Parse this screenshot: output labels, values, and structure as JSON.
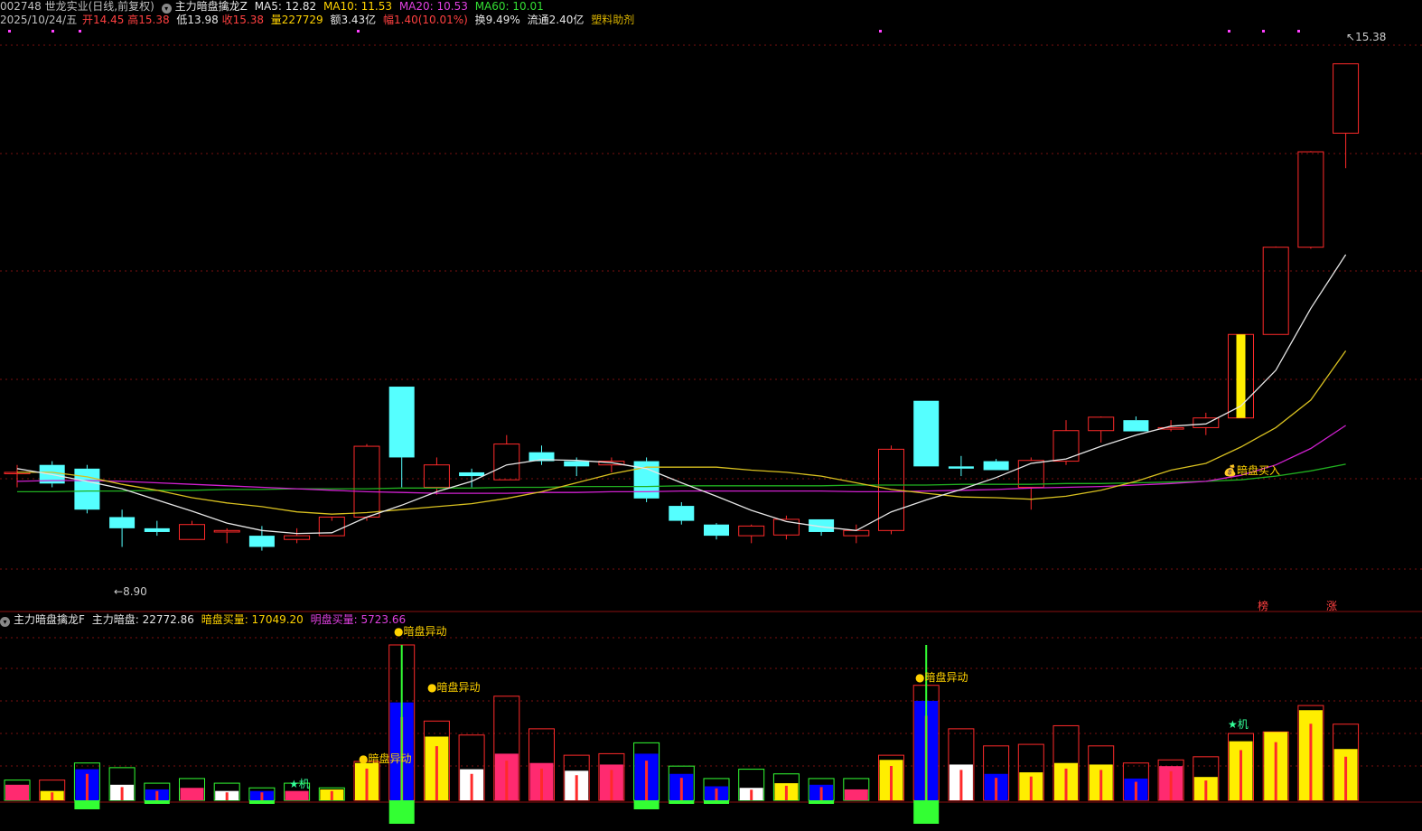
{
  "header": {
    "code_name": "002748 世龙实业(日线,前复权)",
    "indicator_main": "主力暗盘擒龙Z",
    "ma5": "MA5: 12.82",
    "ma10": "MA10: 11.53",
    "ma20": "MA20: 10.53",
    "ma60": "MA60: 10.01",
    "date": "2025/10/24/五",
    "open": "开14.45",
    "high": "高15.38",
    "low": "低13.98",
    "close": "收15.38",
    "volume": "量227729",
    "amount": "额3.43亿",
    "change": "幅1.40(10.01%)",
    "turnover": "换9.49%",
    "float_cap": "流通2.40亿",
    "concept": "塑料助剂"
  },
  "sub_header": {
    "indicator_name": "主力暗盘擒龙F",
    "main_label": "主力暗盘: 22772.86",
    "dark_label": "暗盘买量: 17049.20",
    "light_label": "明盘买量: 5723.66"
  },
  "annotations": {
    "high_price": "15.38",
    "low_price": "8.90",
    "buy_signal": "暗盘买入",
    "bang": "榜",
    "zhang": "涨",
    "anomaly": "●暗盘异动",
    "ji": "★机"
  },
  "colors": {
    "up": "#ff2a2a",
    "down": "#55ffff",
    "ma5": "#e6e6e6",
    "ma10": "#d8c020",
    "ma20": "#d020d0",
    "ma60": "#20b020",
    "grid": "#7a1010",
    "yellow": "#ffee00",
    "magenta": "#ff2a70",
    "blue": "#0000ff",
    "green": "#33ff33"
  },
  "price_chart": {
    "ymin": 8.3,
    "ymax": 15.8,
    "candles": [
      [
        9.9,
        10.0,
        9.7,
        9.9
      ],
      [
        10.0,
        10.05,
        9.7,
        9.75
      ],
      [
        9.95,
        10.0,
        9.35,
        9.4
      ],
      [
        9.3,
        9.4,
        8.9,
        9.15
      ],
      [
        9.15,
        9.25,
        9.05,
        9.1
      ],
      [
        9.0,
        9.25,
        9.0,
        9.2
      ],
      [
        9.1,
        9.15,
        8.95,
        9.12
      ],
      [
        9.05,
        9.18,
        8.85,
        8.9
      ],
      [
        9.0,
        9.15,
        8.95,
        9.05
      ],
      [
        9.05,
        9.25,
        9.05,
        9.3
      ],
      [
        9.3,
        10.28,
        9.25,
        10.25
      ],
      [
        11.05,
        11.05,
        9.7,
        10.1
      ],
      [
        9.7,
        10.1,
        9.6,
        10.0
      ],
      [
        9.9,
        9.95,
        9.7,
        9.85
      ],
      [
        9.8,
        10.4,
        9.8,
        10.28
      ],
      [
        10.17,
        10.26,
        10.0,
        10.05
      ],
      [
        10.05,
        10.1,
        9.85,
        9.98
      ],
      [
        10.0,
        10.1,
        9.9,
        10.05
      ],
      [
        10.05,
        10.1,
        9.5,
        9.55
      ],
      [
        9.45,
        9.5,
        9.2,
        9.25
      ],
      [
        9.2,
        9.22,
        9.0,
        9.05
      ],
      [
        9.05,
        9.2,
        8.95,
        9.18
      ],
      [
        9.06,
        9.32,
        9.0,
        9.27
      ],
      [
        9.27,
        9.27,
        9.05,
        9.1
      ],
      [
        9.05,
        9.2,
        8.95,
        9.12
      ],
      [
        9.12,
        10.26,
        9.07,
        10.21
      ],
      [
        10.86,
        10.86,
        9.98,
        9.98
      ],
      [
        9.98,
        10.12,
        9.85,
        9.95
      ],
      [
        10.05,
        10.08,
        9.95,
        9.93
      ],
      [
        9.7,
        10.1,
        9.4,
        10.06
      ],
      [
        10.05,
        10.6,
        10.0,
        10.46
      ],
      [
        10.46,
        10.65,
        10.3,
        10.64
      ],
      [
        10.6,
        10.65,
        10.45,
        10.45
      ],
      [
        10.48,
        10.6,
        10.45,
        10.5
      ],
      [
        10.5,
        10.7,
        10.4,
        10.63
      ],
      [
        10.63,
        11.75,
        10.63,
        11.75
      ],
      [
        11.75,
        12.93,
        11.75,
        12.92
      ],
      [
        12.92,
        14.21,
        12.9,
        14.2
      ],
      [
        14.45,
        15.38,
        13.98,
        15.38
      ]
    ],
    "ma5": [
      9.95,
      9.87,
      9.78,
      9.68,
      9.53,
      9.38,
      9.22,
      9.12,
      9.08,
      9.09,
      9.3,
      9.46,
      9.64,
      9.78,
      10.0,
      10.07,
      10.06,
      10.03,
      9.95,
      9.76,
      9.58,
      9.39,
      9.24,
      9.17,
      9.12,
      9.37,
      9.53,
      9.67,
      9.83,
      10.02,
      10.08,
      10.25,
      10.4,
      10.52,
      10.55,
      10.79,
      11.27,
      12.1,
      12.82
    ],
    "ma10": [
      9.9,
      9.9,
      9.84,
      9.74,
      9.66,
      9.56,
      9.49,
      9.44,
      9.37,
      9.34,
      9.36,
      9.4,
      9.44,
      9.48,
      9.55,
      9.64,
      9.76,
      9.88,
      9.97,
      9.97,
      9.97,
      9.93,
      9.9,
      9.85,
      9.76,
      9.67,
      9.62,
      9.57,
      9.56,
      9.54,
      9.58,
      9.66,
      9.78,
      9.93,
      10.02,
      10.24,
      10.5,
      10.87,
      11.53
    ],
    "ma20": [
      9.78,
      9.79,
      9.79,
      9.78,
      9.76,
      9.74,
      9.72,
      9.7,
      9.68,
      9.66,
      9.64,
      9.63,
      9.62,
      9.62,
      9.62,
      9.63,
      9.63,
      9.64,
      9.64,
      9.65,
      9.65,
      9.65,
      9.65,
      9.65,
      9.64,
      9.64,
      9.65,
      9.66,
      9.67,
      9.69,
      9.7,
      9.71,
      9.73,
      9.75,
      9.78,
      9.86,
      10.0,
      10.22,
      10.53
    ],
    "ma60": [
      9.64,
      9.64,
      9.65,
      9.65,
      9.66,
      9.66,
      9.67,
      9.67,
      9.68,
      9.68,
      9.68,
      9.69,
      9.69,
      9.69,
      9.7,
      9.7,
      9.71,
      9.71,
      9.71,
      9.72,
      9.72,
      9.72,
      9.72,
      9.72,
      9.73,
      9.73,
      9.73,
      9.74,
      9.74,
      9.74,
      9.75,
      9.75,
      9.76,
      9.77,
      9.78,
      9.8,
      9.85,
      9.92,
      10.01
    ]
  },
  "volume_chart": {
    "vmax": 260000,
    "bars": [
      [
        0.13,
        0.1,
        "magenta",
        "green"
      ],
      [
        0.13,
        0.06,
        "yellow",
        "red"
      ],
      [
        0.24,
        0.2,
        "blue",
        "green"
      ],
      [
        0.21,
        0.1,
        "white",
        "green"
      ],
      [
        0.11,
        0.07,
        "blue",
        "green"
      ],
      [
        0.14,
        0.08,
        "magenta",
        "green"
      ],
      [
        0.11,
        0.06,
        "white",
        "green"
      ],
      [
        0.08,
        0.06,
        "blue",
        "green"
      ],
      [
        0.11,
        0.06,
        "magenta",
        "green"
      ],
      [
        0.08,
        0.07,
        "yellow",
        "green"
      ],
      [
        0.25,
        0.24,
        "yellow",
        "red"
      ],
      [
        1.0,
        0.63,
        "blue",
        "red"
      ],
      [
        0.51,
        0.41,
        "yellow",
        "red"
      ],
      [
        0.42,
        0.2,
        "white",
        "red"
      ],
      [
        0.67,
        0.3,
        "magenta",
        "red"
      ],
      [
        0.46,
        0.24,
        "magenta",
        "red"
      ],
      [
        0.29,
        0.19,
        "white",
        "red"
      ],
      [
        0.3,
        0.23,
        "magenta",
        "red"
      ],
      [
        0.37,
        0.3,
        "blue",
        "green"
      ],
      [
        0.22,
        0.17,
        "blue",
        "green"
      ],
      [
        0.14,
        0.09,
        "blue",
        "green"
      ],
      [
        0.2,
        0.08,
        "white",
        "green"
      ],
      [
        0.17,
        0.11,
        "yellow",
        "green"
      ],
      [
        0.14,
        0.1,
        "blue",
        "green"
      ],
      [
        0.14,
        0.07,
        "magenta",
        "green"
      ],
      [
        0.29,
        0.26,
        "yellow",
        "red"
      ],
      [
        0.74,
        0.64,
        "blue",
        "red"
      ],
      [
        0.46,
        0.23,
        "white",
        "red"
      ],
      [
        0.35,
        0.17,
        "blue",
        "red"
      ],
      [
        0.36,
        0.18,
        "yellow",
        "red"
      ],
      [
        0.48,
        0.24,
        "yellow",
        "red"
      ],
      [
        0.35,
        0.23,
        "yellow",
        "red"
      ],
      [
        0.24,
        0.14,
        "blue",
        "red"
      ],
      [
        0.26,
        0.22,
        "magenta",
        "red"
      ],
      [
        0.28,
        0.15,
        "yellow",
        "red"
      ],
      [
        0.43,
        0.38,
        "yellow",
        "red"
      ],
      [
        0.44,
        0.44,
        "yellow",
        "red"
      ],
      [
        0.61,
        0.58,
        "yellow",
        "red"
      ],
      [
        0.49,
        0.33,
        "yellow",
        "red"
      ]
    ]
  }
}
